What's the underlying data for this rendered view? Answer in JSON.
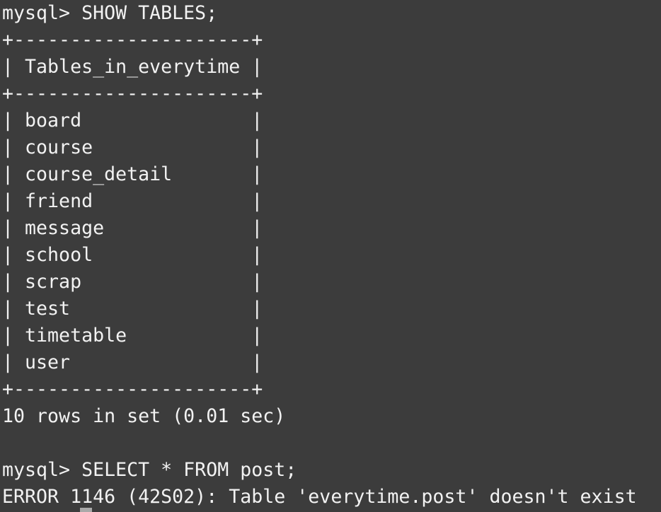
{
  "terminal": {
    "lines": [
      "mysql> SHOW TABLES;",
      "+---------------------+",
      "| Tables_in_everytime |",
      "+---------------------+",
      "| board               |",
      "| course              |",
      "| course_detail       |",
      "| friend              |",
      "| message             |",
      "| school              |",
      "| scrap               |",
      "| test                |",
      "| timetable           |",
      "| user                |",
      "+---------------------+",
      "10 rows in set (0.01 sec)",
      "",
      "mysql> SELECT * FROM post;",
      "ERROR 1146 (42S02): Table 'everytime.post' doesn't exist"
    ]
  },
  "colors": {
    "background": "#3c3c3c",
    "text": "#f2f2f2",
    "cursor": "#a9a9a9"
  }
}
